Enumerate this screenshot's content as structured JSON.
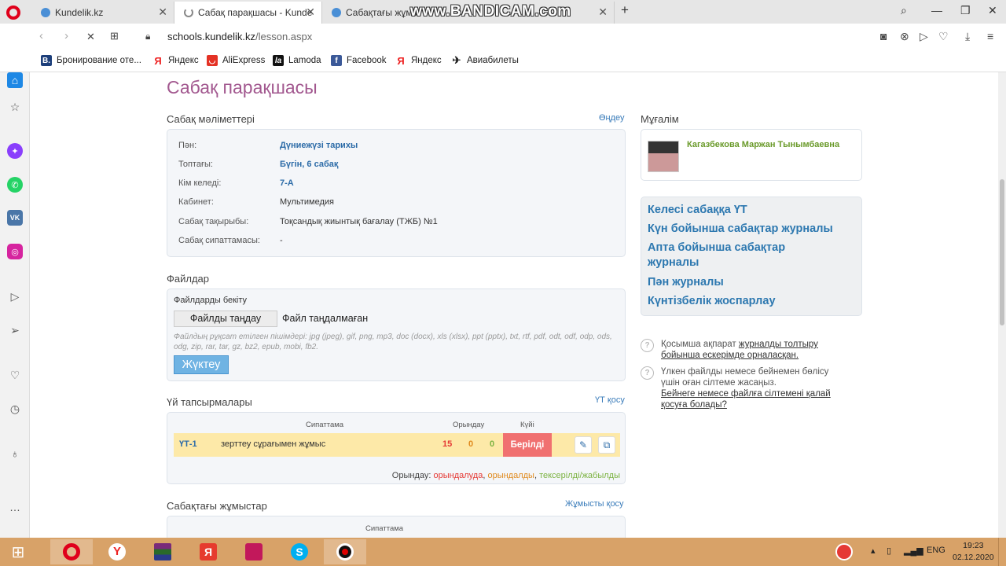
{
  "browser": {
    "tabs": [
      {
        "title": "Kundelik.kz"
      },
      {
        "title": "Сабақ парақшасы - Kunde"
      },
      {
        "title": "Сабақтағы жұмы"
      }
    ],
    "watermark": "www.BANDICAM.com",
    "url_domain": "schools.kundelik.kz",
    "url_path": "/lesson.aspx",
    "bookmarks": [
      {
        "label": "Бронирование оте..."
      },
      {
        "label": "Яндекс"
      },
      {
        "label": "AliExpress"
      },
      {
        "label": "Lamoda"
      },
      {
        "label": "Facebook"
      },
      {
        "label": "Яндекс"
      },
      {
        "label": "Авиабилеты"
      }
    ]
  },
  "page": {
    "title": "Сабақ парақшасы",
    "details": {
      "heading": "Сабақ мәліметтері",
      "edit_link": "Өңдеу",
      "rows": [
        {
          "label": "Пән:",
          "value": "Дүниежүзі тарихы"
        },
        {
          "label": "Топтағы:",
          "value": "Бүгін, 6 сабақ"
        },
        {
          "label": "Кім келеді:",
          "value": "7-А"
        },
        {
          "label": "Кабинет:",
          "value": "Мультимедия"
        },
        {
          "label": "Сабақ тақырыбы:",
          "value": "Тоқсандық жиынтық бағалау (ТЖБ) №1"
        },
        {
          "label": "Сабақ сипаттамасы:",
          "value": "-"
        }
      ]
    },
    "files": {
      "heading": "Файлдар",
      "attach_label": "Файлдарды бекіту",
      "choose_button": "Файлды таңдау",
      "no_file": "Файл таңдалмаған",
      "formats": "Файлдың рұқсат етілген пішімдері: jpg (jpeg), gif, png, mp3, doc (docx), xls (xlsx), ppt (pptx), txt, rtf, pdf, odt, odf, odp, ods, odg, zip, rar, tar, gz, bz2, epub, mobi, fb2.",
      "upload_button": "Жүктеу"
    },
    "homework": {
      "heading": "Үй тапсырмалары",
      "add_link": "ҮТ қосу",
      "col_description": "Сипаттама",
      "col_done": "Орындау",
      "col_status": "Күйі",
      "row": {
        "id": "ҮТ-1",
        "description": "зерттеу сұрағымен жұмыс",
        "done_count": "15",
        "partial_count": "0",
        "checked_count": "0",
        "status": "Берілді"
      },
      "legend_prefix": "Орындау:",
      "legend_done": "орындалуда",
      "legend_partial": "орындалды",
      "legend_checked": "тексерілді/жабылды",
      "colors": {
        "done": "#e53935",
        "partial": "#e08a1e",
        "checked": "#7cb342"
      }
    },
    "lesson_work": {
      "heading": "Сабақтағы жұмыстар",
      "add_link": "Жұмысты қосу",
      "col_description": "Сипаттама"
    },
    "teacher": {
      "heading": "Мұғалім",
      "name": "Кагазбекова Маржан Тынымбаевна"
    },
    "quick_links": [
      "Келесі сабаққа ҮТ",
      "Күн бойынша сабақтар журналы",
      "Апта бойынша сабақтар журналы",
      "Пән журналы",
      "Күнтізбелік жоспарлау"
    ],
    "hints": [
      {
        "text": "Қосымша ақпарат ",
        "link": "журналды толтыру бойынша ескерімде орналасқан."
      },
      {
        "text": "Үлкен файлды немесе бейнемен бөлісу үшін оған сілтеме жасаңыз.",
        "link": "Бейнеге немесе файлға сілтемені қалай қосуға болады?"
      }
    ]
  },
  "taskbar": {
    "lang": "ENG",
    "time": "19:23",
    "date": "02.12.2020"
  }
}
